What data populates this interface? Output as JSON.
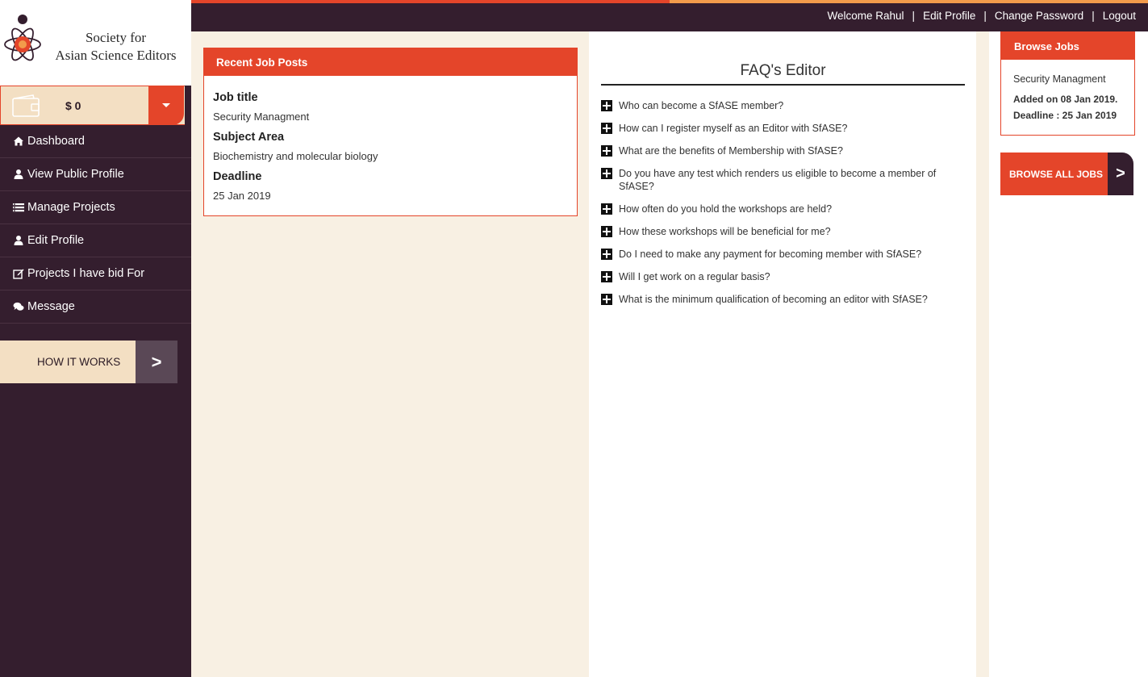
{
  "brand": {
    "line1": "Society for",
    "line2": "Asian Science Editors"
  },
  "wallet": {
    "amount": "$ 0",
    "icon": "wallet-icon"
  },
  "sidebar": {
    "items": [
      {
        "label": "Dashboard",
        "icon": "home-icon"
      },
      {
        "label": "View Public Profile",
        "icon": "user-icon"
      },
      {
        "label": "Manage Projects",
        "icon": "list-icon"
      },
      {
        "label": "Edit Profile",
        "icon": "user-icon"
      },
      {
        "label": "Projects I have bid For",
        "icon": "edit-icon"
      },
      {
        "label": "Message",
        "icon": "comments-icon"
      }
    ],
    "how_it_works": "HOW IT WORKS",
    "how_it_works_arrow": ">"
  },
  "topnav": {
    "welcome": "Welcome Rahul",
    "separator": "|",
    "edit_profile": "Edit Profile",
    "change_password": "Change Password",
    "logout": "Logout"
  },
  "recent_jobs": {
    "heading": "Recent Job Posts",
    "job_title_label": "Job title",
    "job_title": "Security Managment",
    "subject_label": "Subject Area",
    "subject": "Biochemistry and molecular biology",
    "deadline_label": "Deadline",
    "deadline": "25 Jan 2019"
  },
  "faq": {
    "title": "FAQ's Editor",
    "questions": [
      "Who can become a SfASE member?",
      "How can I register myself as an Editor with SfASE?",
      "What are the benefits of Membership with SfASE?",
      "Do you have any test which renders us eligible to become a member of SfASE?",
      "How often do you hold the workshops are held?",
      "How these workshops will be beneficial for me?",
      "Do I need to make any payment for becoming member with SfASE?",
      "Will I get work on a regular basis?",
      "What is the minimum qualification of becoming an editor with SfASE?"
    ]
  },
  "browse": {
    "heading": "Browse Jobs",
    "title": "Security Managment",
    "added": "Added on 08 Jan 2019.",
    "deadline": "Deadline : 25 Jan 2019",
    "browse_all": "BROWSE ALL JOBS",
    "browse_all_arrow": ">"
  },
  "colors": {
    "accent": "#e4452a",
    "dark": "#341e2e",
    "cream": "#f8f0e3",
    "beige": "#f3dfc3",
    "orange_light": "#f29b4b"
  }
}
